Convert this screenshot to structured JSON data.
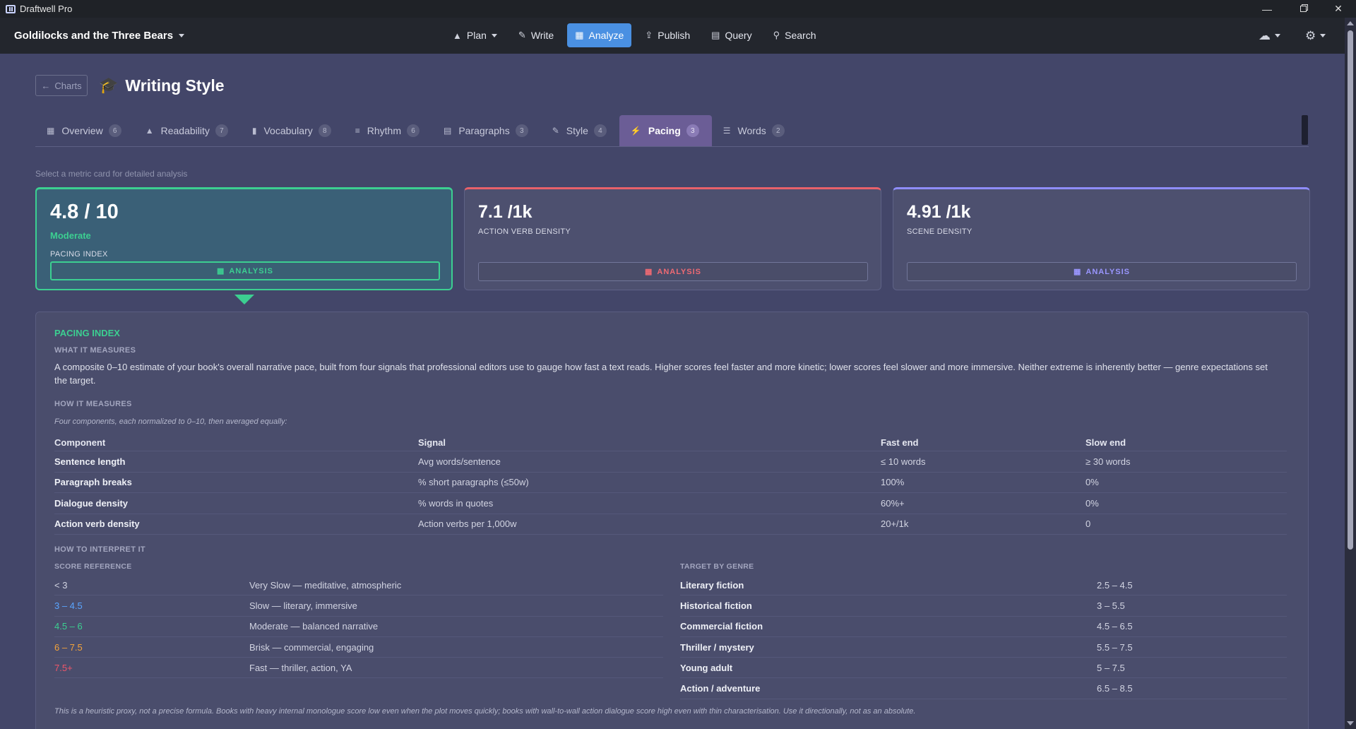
{
  "window": {
    "title": "Draftwell Pro"
  },
  "appbar": {
    "book_title": "Goldilocks and the Three Bears",
    "nav": [
      {
        "label": "Plan",
        "icon": "sitemap-icon"
      },
      {
        "label": "Write",
        "icon": "pencil-icon"
      },
      {
        "label": "Analyze",
        "icon": "bar-chart-icon"
      },
      {
        "label": "Publish",
        "icon": "upload-icon"
      },
      {
        "label": "Query",
        "icon": "table-icon"
      },
      {
        "label": "Search",
        "icon": "search-icon"
      }
    ],
    "active_nav": "Analyze"
  },
  "page": {
    "back_label": "Charts",
    "title": "Writing Style",
    "hint": "Select a metric card for detailed analysis"
  },
  "tabs": [
    {
      "label": "Overview",
      "count": "6",
      "icon": "grid-icon"
    },
    {
      "label": "Readability",
      "count": "7",
      "icon": "graduation-cap-icon"
    },
    {
      "label": "Vocabulary",
      "count": "8",
      "icon": "book-icon"
    },
    {
      "label": "Rhythm",
      "count": "6",
      "icon": "align-left-icon"
    },
    {
      "label": "Paragraphs",
      "count": "3",
      "icon": "paragraph-icon"
    },
    {
      "label": "Style",
      "count": "4",
      "icon": "pencil-icon"
    },
    {
      "label": "Pacing",
      "count": "3",
      "icon": "bolt-icon"
    },
    {
      "label": "Words",
      "count": "2",
      "icon": "list-icon"
    }
  ],
  "active_tab": "Pacing",
  "cards": [
    {
      "value": "4.8 / 10",
      "rating": "Moderate",
      "label": "PACING INDEX",
      "button": "ANALYSIS",
      "accent": "#3ccf91"
    },
    {
      "value": "7.1 /1k",
      "label": "ACTION VERB DENSITY",
      "button": "ANALYSIS",
      "accent": "#e8616a"
    },
    {
      "value": "4.91 /1k",
      "label": "SCENE DENSITY",
      "button": "ANALYSIS",
      "accent": "#8f8dff"
    }
  ],
  "detail": {
    "title": "PACING INDEX",
    "what_heading": "WHAT IT MEASURES",
    "what_text": "A composite 0–10 estimate of your book's overall narrative pace, built from four signals that professional editors use to gauge how fast a text reads. Higher scores feel faster and more kinetic; lower scores feel slower and more immersive. Neither extreme is inherently better — genre expectations set the target.",
    "how_heading": "HOW IT MEASURES",
    "how_intro": "Four components, each normalized to 0–10, then averaged equally:",
    "components_header": [
      "Component",
      "Signal",
      "Fast end",
      "Slow end"
    ],
    "components": [
      [
        "Sentence length",
        "Avg words/sentence",
        "≤ 10 words",
        "≥ 30 words"
      ],
      [
        "Paragraph breaks",
        "% short paragraphs (≤50w)",
        "100%",
        "0%"
      ],
      [
        "Dialogue density",
        "% words in quotes",
        "60%+",
        "0%"
      ],
      [
        "Action verb density",
        "Action verbs per 1,000w",
        "20+/1k",
        "0"
      ]
    ],
    "interpret_heading": "HOW TO INTERPRET IT",
    "score_heading": "SCORE REFERENCE",
    "scores": [
      {
        "range": "< 3",
        "desc": "Very Slow — meditative, atmospheric",
        "color": "#d2d4e2"
      },
      {
        "range": "3 – 4.5",
        "desc": "Slow — literary, immersive",
        "color": "#5aa5ff"
      },
      {
        "range": "4.5 – 6",
        "desc": "Moderate — balanced narrative",
        "color": "#3ccf91"
      },
      {
        "range": "6 – 7.5",
        "desc": "Brisk — commercial, engaging",
        "color": "#f5a33a"
      },
      {
        "range": "7.5+",
        "desc": "Fast — thriller, action, YA",
        "color": "#f0566a"
      }
    ],
    "genre_heading": "TARGET BY GENRE",
    "genres": [
      [
        "Literary fiction",
        "2.5 – 4.5"
      ],
      [
        "Historical fiction",
        "3 – 5.5"
      ],
      [
        "Commercial fiction",
        "4.5 – 6.5"
      ],
      [
        "Thriller / mystery",
        "5.5 – 7.5"
      ],
      [
        "Young adult",
        "5 – 7.5"
      ],
      [
        "Action / adventure",
        "6.5 – 8.5"
      ]
    ],
    "footnote": "This is a heuristic proxy, not a precise formula. Books with heavy internal monologue score low even when the plot moves quickly; books with wall-to-wall action dialogue score high even with thin characterisation. Use it directionally, not as an absolute."
  }
}
